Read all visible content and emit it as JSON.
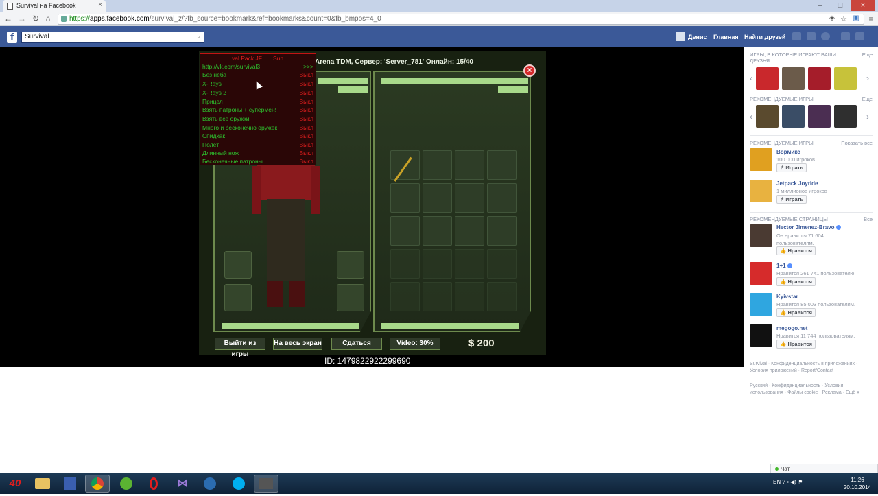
{
  "browser": {
    "tab_title": "Survival на Facebook",
    "tab_close": "×",
    "url_scheme": "https://",
    "url_host": "apps.facebook.com",
    "url_path": "/survival_z/?fb_source=bookmark&ref=bookmarks&count=0&fb_bmpos=4_0",
    "window_controls": [
      "–",
      "□",
      "×"
    ],
    "nav_icons": [
      "back-icon",
      "forward-icon",
      "reload-icon",
      "home-icon"
    ]
  },
  "facebook": {
    "logo": "f",
    "search_value": "Survival",
    "user_name": "Денис",
    "home_label": "Главная",
    "find_friends_label": "Найти друзей"
  },
  "game": {
    "server_title": "Arena TDM, Сервер: 'Server_781' Онлайн: 15/40",
    "close_symbol": "×",
    "buttons": {
      "exit": "Выйти из игры",
      "fullscreen": "На весь экран",
      "surrender": "Сдаться",
      "video": "Video: 30%"
    },
    "money": "$ 200",
    "id_text": "ID: 1479822922299690"
  },
  "cheat_menu": {
    "title": "val Pack JF",
    "title_right": "Sun",
    "link": "http://vk.com/survival3",
    "link_arrow": ">>>",
    "items": [
      {
        "label": "Без неба",
        "state": "Выкл"
      },
      {
        "label": "X-Rays",
        "state": "Выкл"
      },
      {
        "label": "X-Rays 2",
        "state": "Выкл"
      },
      {
        "label": "Прицел",
        "state": "Выкл"
      },
      {
        "label": "Взять патроны + супермен!",
        "state": "Выкл"
      },
      {
        "label": "Взять все оружки",
        "state": "Выкл"
      },
      {
        "label": "Много и бесконечно оружек",
        "state": "Выкл"
      },
      {
        "label": "Спидхак",
        "state": "Выкл"
      },
      {
        "label": "Полёт",
        "state": "Выкл"
      },
      {
        "label": "Длинный нож",
        "state": "Выкл"
      },
      {
        "label": "Бесконечные патроны",
        "state": "Выкл"
      }
    ]
  },
  "sidebar": {
    "friends_games_header": "ИГРЫ, В КОТОРЫЕ ИГРАЮТ ВАШИ ДРУЗЬЯ",
    "friends_games_more": "Еще",
    "rec_games_header": "РЕКОМЕНДУЕМЫЕ ИГРЫ",
    "rec_games_more": "Еще",
    "rec_games2_header": "РЕКОМЕНДУЕМЫЕ ИГРЫ",
    "rec_games2_more": "Показать все",
    "games": [
      {
        "name": "Вормикс",
        "sub": "100 000 игроков",
        "button": "Играть"
      },
      {
        "name": "Jetpack Joyride",
        "sub": "1 миллионов игроков",
        "button": "Играть"
      }
    ],
    "pages_header": "РЕКОМЕНДУЕМЫЕ СТРАНИЦЫ",
    "pages_more": "Все",
    "pages": [
      {
        "name": "Hector Jimenez-Bravo",
        "sub": "Он нравится 71 604 пользователям.",
        "button": "Нравится"
      },
      {
        "name": "1+1",
        "sub": "Нравится 261 741 пользователю.",
        "button": "Нравится"
      },
      {
        "name": "Kyivstar",
        "sub": "Нравится 85 003 пользователям.",
        "button": "Нравится"
      },
      {
        "name": "megogo.net",
        "sub": "Нравится 11 744 пользователям.",
        "button": "Нравится"
      }
    ],
    "footer1": "Survival · Конфиденциальность в приложениях · Условия приложений · Report/Contact",
    "footer2": "Русский · Конфиденциальность · Условия использования · Файлы cookie · Реклама · Ещё ▾",
    "chat_label": "Чат"
  },
  "taskbar": {
    "tray_lang": "EN",
    "time": "11:26",
    "date": "20.10.2014"
  },
  "colors": {
    "fb_blue": "#3b5998",
    "cheat_green": "#2ec22e",
    "cheat_red": "#e01e1e",
    "game_bar": "#a8d98a"
  }
}
